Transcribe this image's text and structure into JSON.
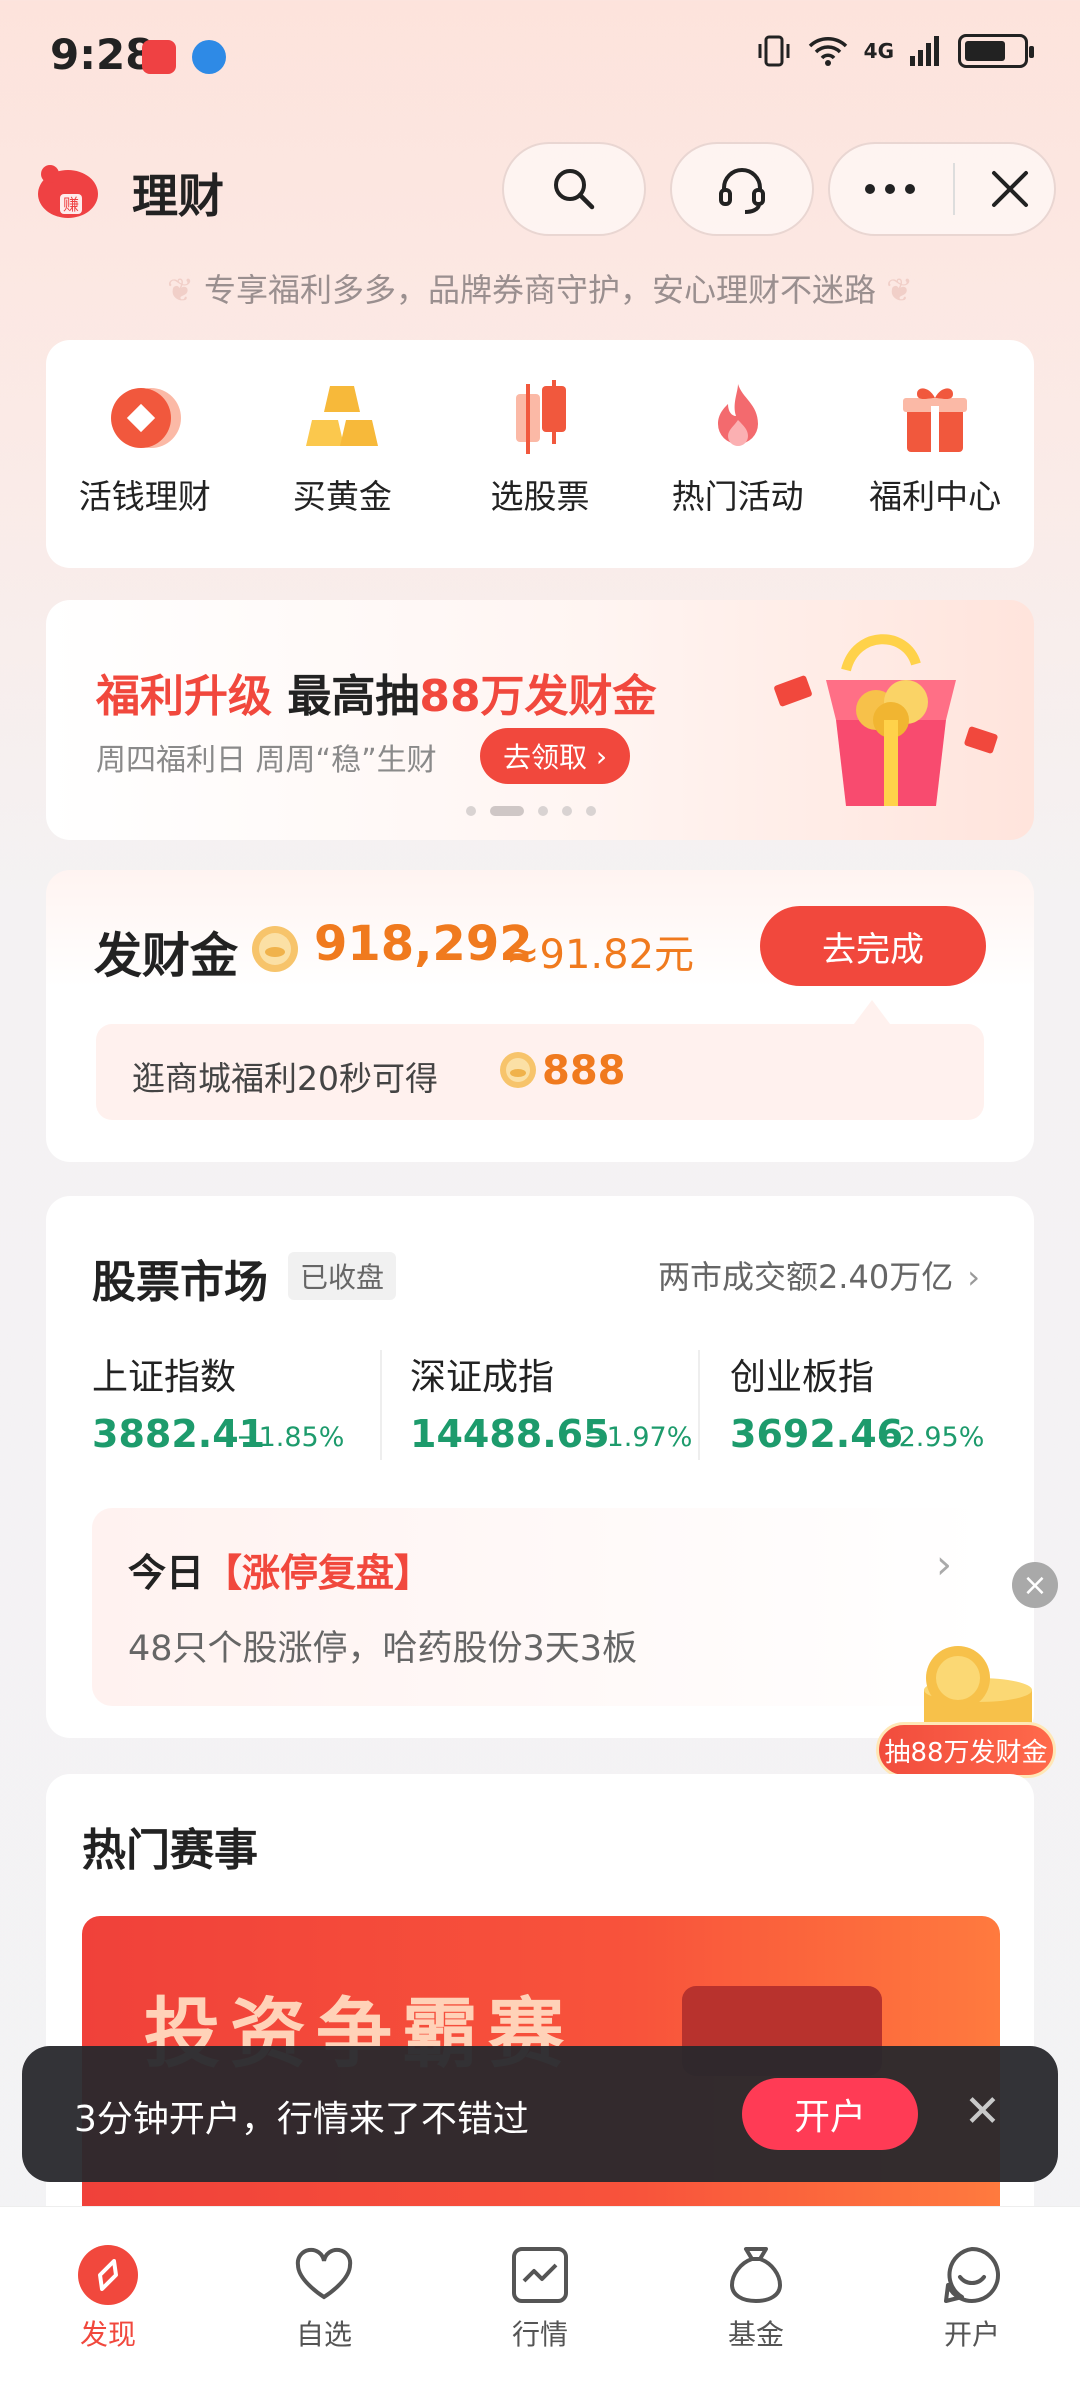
{
  "status_bar": {
    "time": "9:28",
    "network": "4G"
  },
  "header": {
    "title": "理财",
    "subtitle": "专享福利多多，品牌券商守护，安心理财不迷路",
    "icons": [
      "search-icon",
      "headset-icon",
      "more-icon",
      "close-icon"
    ]
  },
  "quick_entries": [
    {
      "label": "活钱理财",
      "icon": "coin-icon"
    },
    {
      "label": "买黄金",
      "icon": "gold-bars-icon"
    },
    {
      "label": "选股票",
      "icon": "candlestick-icon"
    },
    {
      "label": "热门活动",
      "icon": "flame-icon"
    },
    {
      "label": "福利中心",
      "icon": "gift-icon"
    }
  ],
  "banner": {
    "title_part1": "福利升级",
    "title_part2": "最高抽",
    "title_part3": "88万发财金",
    "subtitle": "周四福利日 周周“稳”生财",
    "button": "去领取",
    "page_count": 5,
    "active_page": 2
  },
  "fortune": {
    "label": "发财金",
    "amount": "918,292",
    "approx": "≈91.82元",
    "button": "去完成",
    "tip_text": "逛商城福利20秒可得",
    "tip_amount": "888"
  },
  "market": {
    "title": "股票市场",
    "badge": "已收盘",
    "volume": "两市成交额2.40万亿",
    "indices": [
      {
        "name": "上证指数",
        "value": "3882.41",
        "change": "−1.85%"
      },
      {
        "name": "深证成指",
        "value": "14488.65",
        "change": "−1.97%"
      },
      {
        "name": "创业板指",
        "value": "3692.46",
        "change": "−2.95%"
      }
    ],
    "review": {
      "title_prefix": "今日",
      "title_highlight": "【涨停复盘】",
      "desc": "48只个股涨停，哈药股份3天3板"
    }
  },
  "floating_promo": {
    "label": "抽88万发财金"
  },
  "events": {
    "title": "热门赛事",
    "banner_text": "投资争霸赛"
  },
  "open_account_bar": {
    "text": "3分钟开户，行情来了不错过",
    "button": "开户"
  },
  "bottom_nav": [
    {
      "label": "发现",
      "icon": "discover-icon",
      "active": true
    },
    {
      "label": "自选",
      "icon": "heart-icon",
      "active": false
    },
    {
      "label": "行情",
      "icon": "chart-icon",
      "active": false
    },
    {
      "label": "基金",
      "icon": "money-bag-icon",
      "active": false
    },
    {
      "label": "开户",
      "icon": "smile-chat-icon",
      "active": false
    }
  ],
  "colors": {
    "accent": "#f1483d",
    "orange": "#f07a1e",
    "down_green": "#1d9b6c",
    "toast_bg": "#28282c",
    "open_btn": "#ff3b55"
  }
}
